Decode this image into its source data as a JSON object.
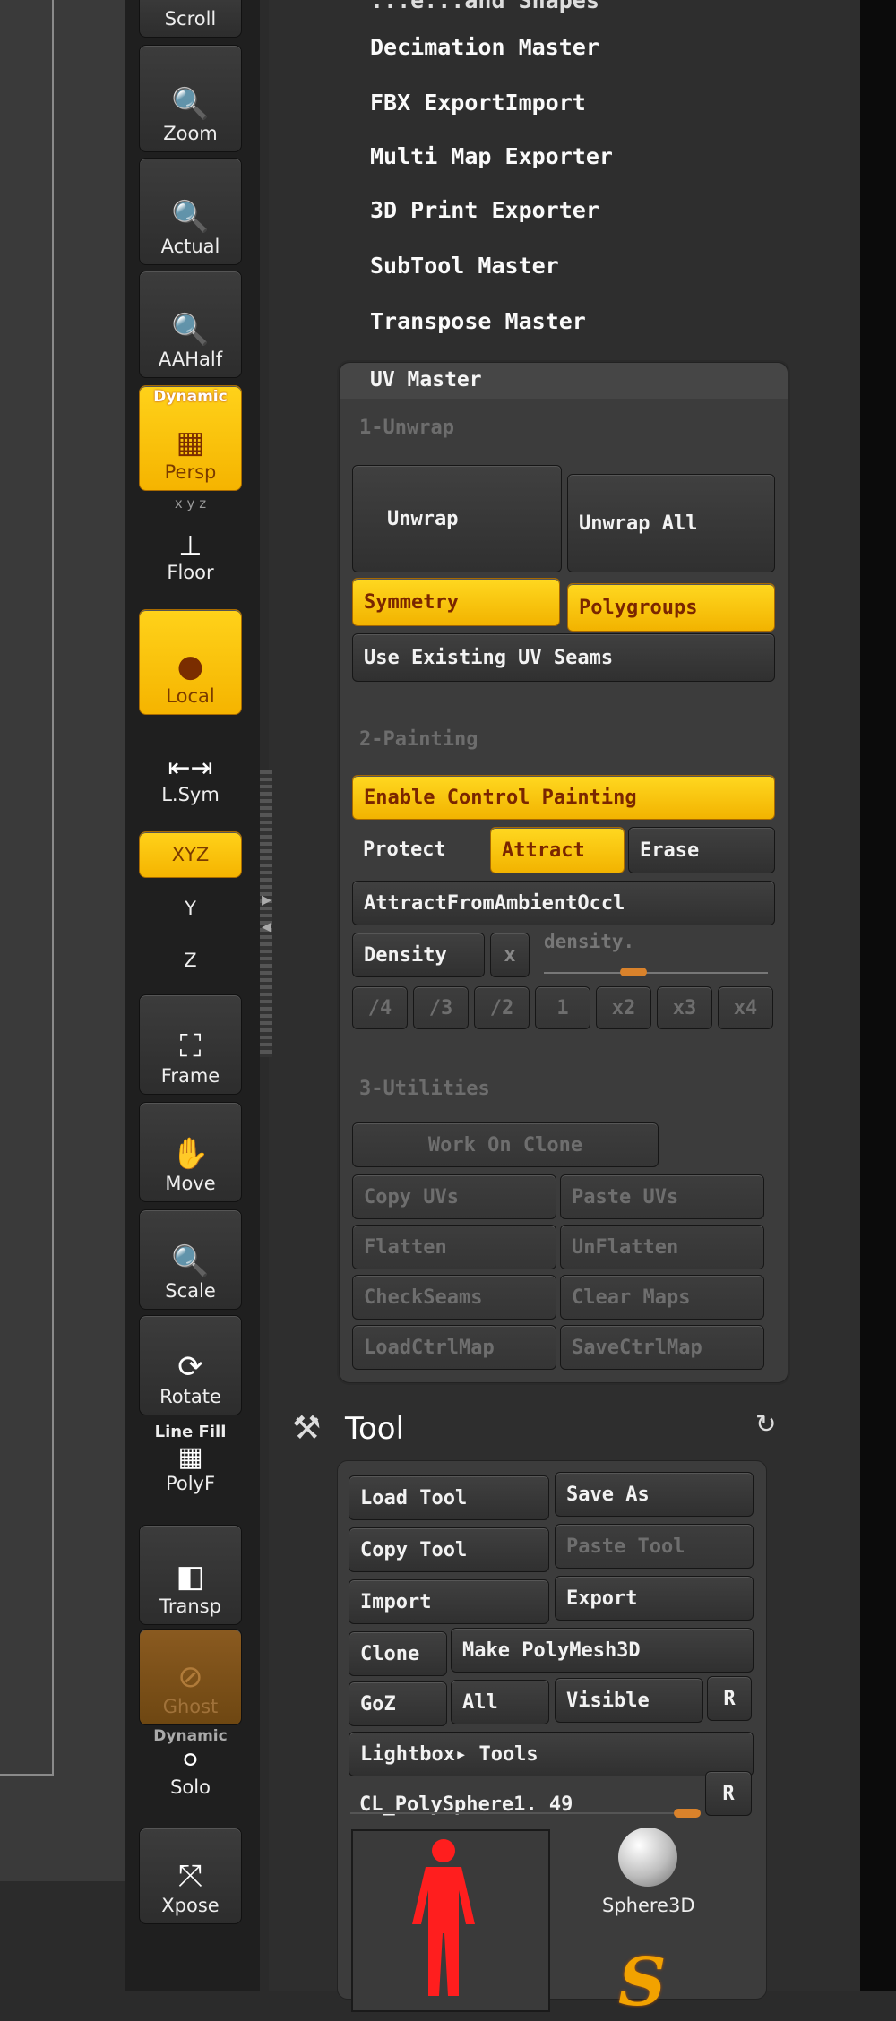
{
  "toolbar": {
    "scroll": "Scroll",
    "zoom": "Zoom",
    "actual": "Actual",
    "aahalf": "AAHalf",
    "persp_top": "Dynamic",
    "persp": "Persp",
    "floor_axes": "x y z",
    "floor": "Floor",
    "local": "Local",
    "lsym": "L.Sym",
    "xyz": "XYZ",
    "y": "Y",
    "z": "Z",
    "frame": "Frame",
    "move": "Move",
    "scale": "Scale",
    "rotate": "Rotate",
    "linefill_top": "Line Fill",
    "polyf": "PolyF",
    "transp": "Transp",
    "ghost": "Ghost",
    "solo_top": "Dynamic",
    "solo": "Solo",
    "xpose": "Xpose"
  },
  "plugins": {
    "partial": "...e...and Shapes",
    "items": [
      "Decimation Master",
      "FBX ExportImport",
      "Multi Map Exporter",
      "3D Print Exporter",
      "SubTool Master",
      "Transpose Master"
    ]
  },
  "uv_master": {
    "title": "UV Master",
    "section1": "1-Unwrap",
    "unwrap": "Unwrap",
    "unwrap_all": "Unwrap All",
    "symmetry": "Symmetry",
    "polygroups": "Polygroups",
    "use_existing": "Use Existing UV Seams",
    "section2": "2-Painting",
    "enable_control": "Enable Control Painting",
    "protect": "Protect",
    "attract": "Attract",
    "erase": "Erase",
    "attract_ambient": "AttractFromAmbientOccl",
    "density": "Density",
    "density_x": "x",
    "density_slider_label": "density.",
    "density_value": 0.4,
    "multipliers": [
      "/4",
      "/3",
      "/2",
      "1",
      "x2",
      "x3",
      "x4"
    ],
    "section3": "3-Utilities",
    "work_on_clone": "Work On Clone",
    "copy_uvs": "Copy UVs",
    "paste_uvs": "Paste UVs",
    "flatten": "Flatten",
    "unflatten": "UnFlatten",
    "checkseams": "CheckSeams",
    "clear_maps": "Clear Maps",
    "loadctrlmap": "LoadCtrlMap",
    "savectrlmap": "SaveCtrlMap"
  },
  "tool": {
    "title": "Tool",
    "load_tool": "Load Tool",
    "save_as": "Save As",
    "copy_tool": "Copy Tool",
    "paste_tool": "Paste Tool",
    "import": "Import",
    "export": "Export",
    "clone": "Clone",
    "make_polymesh": "Make PolyMesh3D",
    "goz": "GoZ",
    "all": "All",
    "visible": "Visible",
    "r": "R",
    "lightbox_tools": "Lightbox▸ Tools",
    "current_tool": "CL_PolySphere1. 49",
    "tool_slider_value": 1.0,
    "sphere3d": "Sphere3D"
  },
  "colors": {
    "accent_yellow": "#f5b400",
    "active_text": "#7a2600",
    "panel_bg": "#3c3c3c",
    "disabled_text": "#6e6e6e"
  }
}
